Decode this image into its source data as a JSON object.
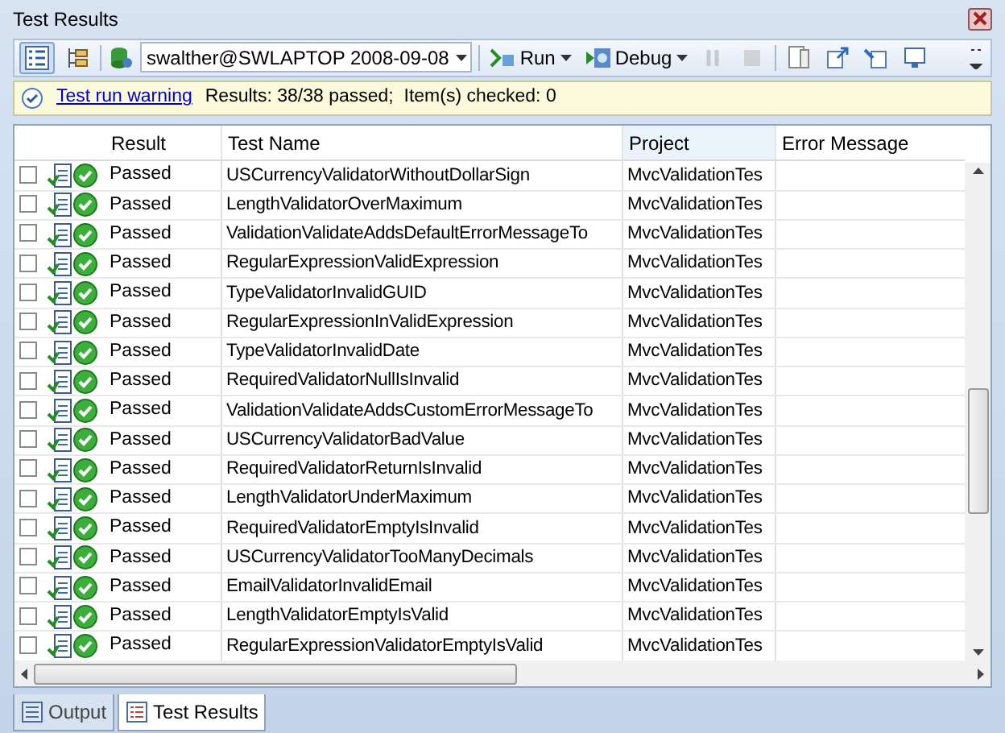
{
  "window": {
    "title": "Test Results"
  },
  "toolbar": {
    "run_config": "swalther@SWLAPTOP 2008-09-08",
    "buttons": [
      {
        "kind": "run",
        "label": "Run",
        "disabled": false
      },
      {
        "kind": "debug",
        "label": "Debug",
        "disabled": false
      },
      {
        "kind": "pause",
        "disabled": true
      },
      {
        "kind": "stop",
        "disabled": true
      }
    ]
  },
  "info_bar": {
    "link": "Test run warning",
    "summary": "Results: 38/38 passed;  Item(s) checked: 0"
  },
  "table": {
    "columns": [
      "Result",
      "Test Name",
      "Project",
      "Error Message"
    ],
    "rows": [
      {
        "checked": false,
        "result": "Passed",
        "name": "USCurrencyValidatorWithoutDollarSign",
        "project": "MvcValidationTes"
      },
      {
        "checked": false,
        "result": "Passed",
        "name": "LengthValidatorOverMaximum",
        "project": "MvcValidationTes"
      },
      {
        "checked": false,
        "result": "Passed",
        "name": "ValidationValidateAddsDefaultErrorMessageTo",
        "project": "MvcValidationTes"
      },
      {
        "checked": false,
        "result": "Passed",
        "name": "RegularExpressionValidExpression",
        "project": "MvcValidationTes"
      },
      {
        "checked": false,
        "result": "Passed",
        "name": "TypeValidatorInvalidGUID",
        "project": "MvcValidationTes"
      },
      {
        "checked": false,
        "result": "Passed",
        "name": "RegularExpressionInValidExpression",
        "project": "MvcValidationTes"
      },
      {
        "checked": false,
        "result": "Passed",
        "name": "TypeValidatorInvalidDate",
        "project": "MvcValidationTes"
      },
      {
        "checked": false,
        "result": "Passed",
        "name": "RequiredValidatorNullIsInvalid",
        "project": "MvcValidationTes"
      },
      {
        "checked": false,
        "result": "Passed",
        "name": "ValidationValidateAddsCustomErrorMessageTo",
        "project": "MvcValidationTes"
      },
      {
        "checked": false,
        "result": "Passed",
        "name": "USCurrencyValidatorBadValue",
        "project": "MvcValidationTes"
      },
      {
        "checked": false,
        "result": "Passed",
        "name": "RequiredValidatorReturnIsInvalid",
        "project": "MvcValidationTes"
      },
      {
        "checked": false,
        "result": "Passed",
        "name": "LengthValidatorUnderMaximum",
        "project": "MvcValidationTes"
      },
      {
        "checked": false,
        "result": "Passed",
        "name": "RequiredValidatorEmptyIsInvalid",
        "project": "MvcValidationTes"
      },
      {
        "checked": false,
        "result": "Passed",
        "name": "USCurrencyValidatorTooManyDecimals",
        "project": "MvcValidationTes"
      },
      {
        "checked": false,
        "result": "Passed",
        "name": "EmailValidatorInvalidEmail",
        "project": "MvcValidationTes"
      },
      {
        "checked": false,
        "result": "Passed",
        "name": "LengthValidatorEmptyIsValid",
        "project": "MvcValidationTes"
      },
      {
        "checked": false,
        "result": "Passed",
        "name": "RegularExpressionValidatorEmptyIsValid",
        "project": "MvcValidationTes"
      }
    ]
  },
  "bottom_tabs": [
    {
      "label": "Output",
      "selected": false
    },
    {
      "label": "Test Results",
      "selected": true
    }
  ]
}
